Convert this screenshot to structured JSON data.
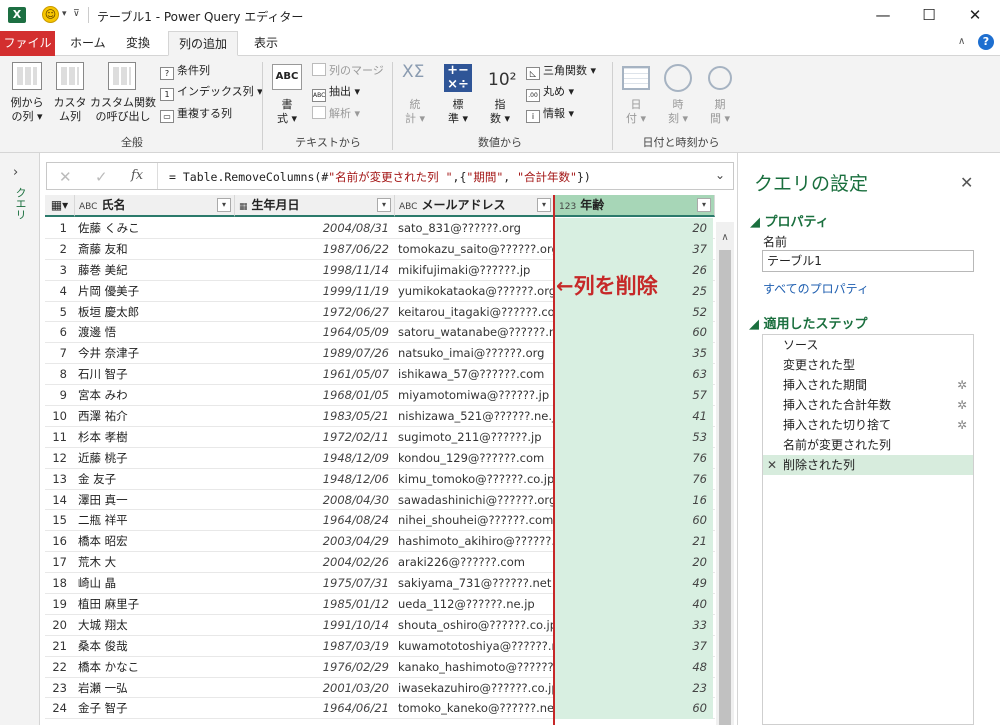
{
  "titlebar": {
    "app_icon": "X",
    "title": "テーブル1 - Power Query エディター",
    "min": "—",
    "max": "☐",
    "close": "✕"
  },
  "tabs": [
    {
      "label": "ファイル"
    },
    {
      "label": "ホーム"
    },
    {
      "label": "変換"
    },
    {
      "label": "列の追加"
    },
    {
      "label": "表示"
    }
  ],
  "ribbon": {
    "general": {
      "group_label": "全般",
      "btn1": [
        "例から",
        "の列 ▾"
      ],
      "btn2": [
        "カスタ",
        "ム列"
      ],
      "btn3": [
        "カスタム関数",
        "の呼び出し"
      ],
      "small": [
        "条件列",
        "インデックス列 ▾",
        "重複する列"
      ]
    },
    "text": {
      "group_label": "テキストから",
      "big": [
        "書",
        "式 ▾"
      ],
      "small": [
        "列のマージ",
        "抽出 ▾",
        "解析 ▾"
      ]
    },
    "number": {
      "group_label": "数値から",
      "b1": [
        "統",
        "計 ▾"
      ],
      "b2": [
        "標",
        "準 ▾"
      ],
      "b3": [
        "指",
        "数 ▾"
      ],
      "small": [
        "三角関数 ▾",
        "丸め ▾",
        "情報 ▾"
      ]
    },
    "date": {
      "group_label": "日付と時刻から",
      "b1": [
        "日",
        "付 ▾"
      ],
      "b2": [
        "時",
        "刻 ▾"
      ],
      "b3": [
        "期",
        "間 ▾"
      ]
    }
  },
  "left_pane": {
    "label": "クエリ"
  },
  "formula": {
    "text_prefix": "= Table.RemoveColumns(#",
    "str1": "\"名前が変更された列 \"",
    "mid": ",{",
    "str2": "\"期間\"",
    "sep": ", ",
    "str3": "\"合計年数\"",
    "end": "})"
  },
  "columns": [
    {
      "type": "ABC",
      "label": "氏名"
    },
    {
      "type": "▦",
      "label": "生年月日"
    },
    {
      "type": "ABC",
      "label": "メールアドレス"
    },
    {
      "type": "123",
      "label": "年齢"
    }
  ],
  "rows": [
    {
      "n": "1",
      "name": "佐藤 くみこ",
      "date": "2004/08/31",
      "mail": "sato_831@??????.org",
      "age": "20"
    },
    {
      "n": "2",
      "name": "斎藤 友和",
      "date": "1987/06/22",
      "mail": "tomokazu_saito@??????.org",
      "age": "37"
    },
    {
      "n": "3",
      "name": "藤巻 美紀",
      "date": "1998/11/14",
      "mail": "mikifujimaki@??????.jp",
      "age": "26"
    },
    {
      "n": "4",
      "name": "片岡 優美子",
      "date": "1999/11/19",
      "mail": "yumikokataoka@??????.org",
      "age": "25"
    },
    {
      "n": "5",
      "name": "板垣 慶太郎",
      "date": "1972/06/27",
      "mail": "keitarou_itagaki@??????.com",
      "age": "52"
    },
    {
      "n": "6",
      "name": "渡邊 悟",
      "date": "1964/05/09",
      "mail": "satoru_watanabe@??????.n...",
      "age": "60"
    },
    {
      "n": "7",
      "name": "今井 奈津子",
      "date": "1989/07/26",
      "mail": "natsuko_imai@??????.org",
      "age": "35"
    },
    {
      "n": "8",
      "name": "石川 智子",
      "date": "1961/05/07",
      "mail": "ishikawa_57@??????.com",
      "age": "63"
    },
    {
      "n": "9",
      "name": "宮本 みわ",
      "date": "1968/01/05",
      "mail": "miyamotomiwa@??????.jp",
      "age": "57"
    },
    {
      "n": "10",
      "name": "西澤 祐介",
      "date": "1983/05/21",
      "mail": "nishizawa_521@??????.ne.jp",
      "age": "41"
    },
    {
      "n": "11",
      "name": "杉本 孝樹",
      "date": "1972/02/11",
      "mail": "sugimoto_211@??????.jp",
      "age": "53"
    },
    {
      "n": "12",
      "name": "近藤 桃子",
      "date": "1948/12/09",
      "mail": "kondou_129@??????.com",
      "age": "76"
    },
    {
      "n": "13",
      "name": "金 友子",
      "date": "1948/12/06",
      "mail": "kimu_tomoko@??????.co.jp",
      "age": "76"
    },
    {
      "n": "14",
      "name": "澤田 真一",
      "date": "2008/04/30",
      "mail": "sawadashinichi@??????.org",
      "age": "16"
    },
    {
      "n": "15",
      "name": "二瓶 祥平",
      "date": "1964/08/24",
      "mail": "nihei_shouhei@??????.com",
      "age": "60"
    },
    {
      "n": "16",
      "name": "橋本 昭宏",
      "date": "2003/04/29",
      "mail": "hashimoto_akihiro@??????.jp",
      "age": "21"
    },
    {
      "n": "17",
      "name": "荒木 大",
      "date": "2004/02/26",
      "mail": "araki226@??????.com",
      "age": "20"
    },
    {
      "n": "18",
      "name": "崎山 晶",
      "date": "1975/07/31",
      "mail": "sakiyama_731@??????.net",
      "age": "49"
    },
    {
      "n": "19",
      "name": "植田 麻里子",
      "date": "1985/01/12",
      "mail": "ueda_112@??????.ne.jp",
      "age": "40"
    },
    {
      "n": "20",
      "name": "大城 翔太",
      "date": "1991/10/14",
      "mail": "shouta_oshiro@??????.co.jp",
      "age": "33"
    },
    {
      "n": "21",
      "name": "桑本 俊哉",
      "date": "1987/03/19",
      "mail": "kuwamototoshiya@??????.net",
      "age": "37"
    },
    {
      "n": "22",
      "name": "橋本 かなこ",
      "date": "1976/02/29",
      "mail": "kanako_hashimoto@??????.jp",
      "age": "48"
    },
    {
      "n": "23",
      "name": "岩瀬 一弘",
      "date": "2001/03/20",
      "mail": "iwasekazuhiro@??????.co.jp",
      "age": "23"
    },
    {
      "n": "24",
      "name": "金子 智子",
      "date": "1964/06/21",
      "mail": "tomoko_kaneko@??????.ne.jp",
      "age": "60"
    }
  ],
  "annotation": "←列を削除",
  "settings": {
    "title": "クエリの設定",
    "properties_header": "◢ プロパティ",
    "name_label": "名前",
    "name_value": "テーブル1",
    "all_props_link": "すべてのプロパティ",
    "steps_header": "◢ 適用したステップ",
    "steps": [
      {
        "label": "ソース",
        "gear": false
      },
      {
        "label": "変更された型",
        "gear": false
      },
      {
        "label": "挿入された期間",
        "gear": true
      },
      {
        "label": "挿入された合計年数",
        "gear": true
      },
      {
        "label": "挿入された切り捨て",
        "gear": true
      },
      {
        "label": "名前が変更された列",
        "gear": false
      },
      {
        "label": "削除された列",
        "gear": false,
        "selected": true
      }
    ]
  },
  "colors": {
    "accent_green": "#1a6f3e",
    "file_tab": "#d32f2f",
    "annotation_red": "#c62828",
    "selected_col": "#d8efe1"
  }
}
